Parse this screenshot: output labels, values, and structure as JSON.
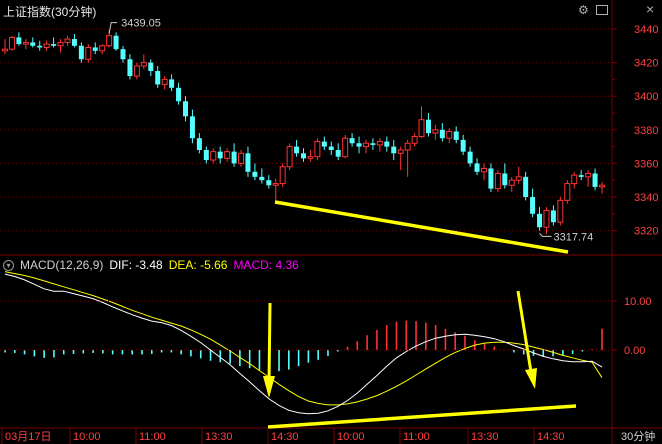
{
  "window": {
    "title": "上证指数(30分钟)",
    "icons": [
      "settings-gear-icon",
      "window-restore-icon",
      "window-close-icon"
    ]
  },
  "price_panel": {
    "axis_ticks": [
      "3440",
      "3420",
      "3400",
      "3380",
      "3360",
      "3340",
      "3320"
    ],
    "annotation_high": "3439.05",
    "annotation_low": "3317.74"
  },
  "macd_panel": {
    "label": "MACD(12,26,9)",
    "dif_text": "DIF: -3.48",
    "dea_text": "DEA: -5.66",
    "macd_text": "MACD: 4.36",
    "axis_ticks": [
      "10.00",
      "0.00"
    ]
  },
  "x_axis": {
    "labels": [
      "03月17日",
      "10:00",
      "11:00",
      "13:30",
      "14:30",
      "10:00",
      "11:00",
      "13:30",
      "14:30"
    ],
    "period": "30分钟"
  },
  "colors": {
    "up": "#ff3232",
    "down": "#54ffff",
    "dif_line": "#ffffff",
    "dea_line": "#ffff00",
    "trendline": "#ffff00",
    "macd_label": "#ff00ff",
    "grid": "#7a0000"
  },
  "chart_data": [
    {
      "type": "candlestick",
      "title": "上证指数(30分钟)",
      "ylim": [
        3310,
        3450
      ],
      "candles": [
        [
          3427,
          3434,
          3425,
          3428
        ],
        [
          3428,
          3436,
          3427,
          3435
        ],
        [
          3435,
          3438,
          3430,
          3431
        ],
        [
          3431,
          3434,
          3428,
          3432
        ],
        [
          3432,
          3435,
          3429,
          3430
        ],
        [
          3430,
          3433,
          3427,
          3429
        ],
        [
          3429,
          3433,
          3427,
          3431
        ],
        [
          3431,
          3435,
          3429,
          3430
        ],
        [
          3430,
          3434,
          3426,
          3432
        ],
        [
          3432,
          3436,
          3430,
          3434
        ],
        [
          3434,
          3437,
          3429,
          3430
        ],
        [
          3430,
          3432,
          3420,
          3422
        ],
        [
          3422,
          3431,
          3420,
          3429
        ],
        [
          3429,
          3432,
          3425,
          3427
        ],
        [
          3427,
          3431,
          3425,
          3430
        ],
        [
          3430,
          3439,
          3429,
          3436
        ],
        [
          3436,
          3438,
          3427,
          3428
        ],
        [
          3428,
          3430,
          3420,
          3422
        ],
        [
          3422,
          3425,
          3410,
          3412
        ],
        [
          3412,
          3420,
          3410,
          3418
        ],
        [
          3418,
          3425,
          3416,
          3420
        ],
        [
          3420,
          3422,
          3412,
          3415
        ],
        [
          3415,
          3418,
          3405,
          3407
        ],
        [
          3407,
          3412,
          3404,
          3410
        ],
        [
          3410,
          3413,
          3403,
          3405
        ],
        [
          3405,
          3408,
          3395,
          3397
        ],
        [
          3397,
          3400,
          3385,
          3388
        ],
        [
          3388,
          3392,
          3372,
          3375
        ],
        [
          3375,
          3378,
          3366,
          3368
        ],
        [
          3368,
          3370,
          3360,
          3362
        ],
        [
          3362,
          3369,
          3360,
          3367
        ],
        [
          3367,
          3370,
          3360,
          3363
        ],
        [
          3363,
          3369,
          3361,
          3367
        ],
        [
          3367,
          3372,
          3358,
          3360
        ],
        [
          3360,
          3368,
          3358,
          3366
        ],
        [
          3366,
          3370,
          3352,
          3355
        ],
        [
          3355,
          3360,
          3350,
          3352
        ],
        [
          3352,
          3357,
          3348,
          3350
        ],
        [
          3350,
          3353,
          3345,
          3347
        ],
        [
          3347,
          3351,
          3337,
          3348
        ],
        [
          3348,
          3360,
          3346,
          3358
        ],
        [
          3358,
          3372,
          3356,
          3370
        ],
        [
          3370,
          3374,
          3364,
          3366
        ],
        [
          3366,
          3369,
          3361,
          3363
        ],
        [
          3363,
          3368,
          3361,
          3364
        ],
        [
          3364,
          3375,
          3362,
          3373
        ],
        [
          3373,
          3376,
          3368,
          3370
        ],
        [
          3370,
          3373,
          3365,
          3368
        ],
        [
          3368,
          3372,
          3362,
          3364
        ],
        [
          3364,
          3377,
          3363,
          3375
        ],
        [
          3375,
          3378,
          3370,
          3372
        ],
        [
          3372,
          3376,
          3366,
          3370
        ],
        [
          3370,
          3374,
          3366,
          3372
        ],
        [
          3372,
          3375,
          3368,
          3371
        ],
        [
          3371,
          3375,
          3367,
          3373
        ],
        [
          3373,
          3376,
          3367,
          3370
        ],
        [
          3370,
          3374,
          3362,
          3366
        ],
        [
          3366,
          3370,
          3356,
          3368
        ],
        [
          3368,
          3374,
          3352,
          3372
        ],
        [
          3372,
          3378,
          3370,
          3376
        ],
        [
          3376,
          3394,
          3375,
          3386
        ],
        [
          3386,
          3390,
          3376,
          3378
        ],
        [
          3378,
          3383,
          3374,
          3380
        ],
        [
          3380,
          3384,
          3373,
          3375
        ],
        [
          3375,
          3381,
          3372,
          3379
        ],
        [
          3379,
          3382,
          3372,
          3374
        ],
        [
          3374,
          3377,
          3365,
          3367
        ],
        [
          3367,
          3370,
          3358,
          3360
        ],
        [
          3360,
          3363,
          3353,
          3355
        ],
        [
          3355,
          3360,
          3350,
          3357
        ],
        [
          3357,
          3360,
          3343,
          3345
        ],
        [
          3345,
          3356,
          3343,
          3354
        ],
        [
          3354,
          3360,
          3345,
          3347
        ],
        [
          3347,
          3352,
          3343,
          3350
        ],
        [
          3350,
          3358,
          3348,
          3352
        ],
        [
          3352,
          3355,
          3338,
          3340
        ],
        [
          3340,
          3345,
          3328,
          3330
        ],
        [
          3330,
          3334,
          3320,
          3322
        ],
        [
          3322,
          3334,
          3318,
          3332
        ],
        [
          3332,
          3335,
          3323,
          3325
        ],
        [
          3325,
          3340,
          3323,
          3338
        ],
        [
          3338,
          3350,
          3336,
          3348
        ],
        [
          3348,
          3355,
          3345,
          3353
        ],
        [
          3353,
          3356,
          3350,
          3352
        ],
        [
          3352,
          3356,
          3346,
          3354
        ],
        [
          3354,
          3357,
          3344,
          3346
        ],
        [
          3346,
          3349,
          3342,
          3347
        ]
      ],
      "annotations": [
        {
          "label": "3439.05",
          "value": 3439.05
        },
        {
          "label": "3317.74",
          "value": 3317.74
        }
      ]
    },
    {
      "type": "bar",
      "title": "MACD(12,26,9)",
      "ylim": [
        -12,
        17
      ],
      "dif": [
        15.5,
        15,
        14.3,
        13.4,
        12.5,
        12,
        12,
        11.5,
        11,
        10.5,
        9.7,
        8.8,
        8,
        7.2,
        6.5,
        5.9,
        5.6,
        5,
        4,
        2.8,
        1.5,
        0,
        -1.5,
        -3,
        -4.8,
        -6.5,
        -8.3,
        -10,
        -11.3,
        -12.3,
        -12.8,
        -13,
        -12.9,
        -12.4,
        -11.5,
        -10.3,
        -8.8,
        -7,
        -5.2,
        -3.3,
        -1.6,
        -0.3,
        0.8,
        1.7,
        2.4,
        2.8,
        3.1,
        3.2,
        3,
        2.7,
        2.3,
        1.7,
        0.9,
        0.2,
        -0.6,
        -1.3,
        -1.8,
        -2.2,
        -2.4,
        -2.4,
        -2.3,
        -3.48
      ],
      "dea": [
        16,
        15.6,
        15.2,
        14.7,
        14.1,
        13.5,
        12.9,
        12.3,
        11.7,
        11.1,
        10.4,
        9.7,
        8.9,
        8.1,
        7.4,
        6.7,
        6.1,
        5.5,
        4.9,
        4.1,
        3.2,
        2.2,
        1,
        -0.2,
        -1.5,
        -2.8,
        -4.2,
        -5.6,
        -7,
        -8.3,
        -9.5,
        -10.4,
        -10.9,
        -11.2,
        -11.2,
        -11,
        -10.6,
        -10,
        -9.3,
        -8.4,
        -7.4,
        -6.3,
        -5.1,
        -3.9,
        -2.7,
        -1.5,
        -0.5,
        0.3,
        1,
        1.4,
        1.6,
        1.6,
        1.4,
        1.1,
        0.6,
        0.1,
        -0.5,
        -1.1,
        -1.6,
        -2.1,
        -2.5,
        -5.66
      ],
      "macd": [
        -0.5,
        -0.6,
        -0.9,
        -1.3,
        -1.6,
        -1.5,
        -0.9,
        -0.8,
        -0.7,
        -0.6,
        -0.7,
        -0.9,
        -0.9,
        -0.9,
        -0.9,
        -0.8,
        -0.5,
        -0.5,
        -0.9,
        -1.3,
        -1.7,
        -2.2,
        -2.5,
        -2.8,
        -3.3,
        -3.7,
        -4.1,
        -4.4,
        -4.3,
        -4,
        -3.3,
        -2.6,
        -2,
        -1.2,
        -0.3,
        0.7,
        1.8,
        3,
        4.1,
        5.1,
        5.8,
        6,
        5.9,
        5.6,
        5.1,
        4.3,
        3.6,
        2.9,
        2,
        1.3,
        0.7,
        0.1,
        -0.5,
        -0.9,
        -1.2,
        -1.4,
        -1.3,
        -1.1,
        -0.8,
        -0.3,
        0.2,
        4.36
      ]
    }
  ]
}
